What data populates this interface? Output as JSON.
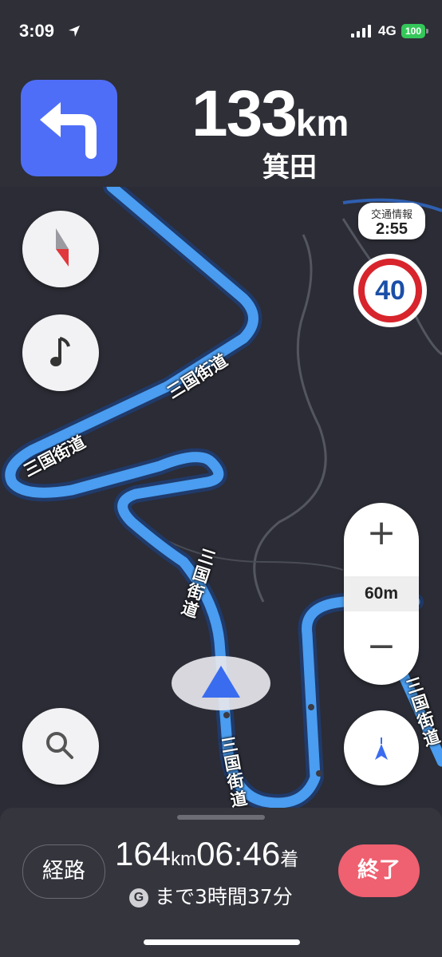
{
  "status_bar": {
    "time": "3:09",
    "network": "4G",
    "battery": "100"
  },
  "navigation": {
    "distance_value": "133",
    "distance_unit": "km",
    "destination_place": "箕田",
    "turn": "left"
  },
  "map": {
    "road_labels": [
      "三国街道",
      "三国街道",
      "三国街道",
      "三国街道",
      "三国街道"
    ],
    "traffic_info": {
      "label": "交通情報",
      "value": "2:55"
    },
    "speed_limit": "40",
    "zoom_scale": "60m",
    "zoom_in": "+",
    "zoom_out": "−"
  },
  "trip": {
    "route_button": "経路",
    "remaining_distance": "164",
    "distance_unit": "km",
    "arrival_time": "06:46",
    "arrival_suffix": "着",
    "g_icon": "G",
    "remaining_time": "まで3時間37分",
    "end_button": "終了"
  },
  "colors": {
    "accent_blue": "#4f6ef7",
    "route_blue": "#4a9df0",
    "end_red": "#ef6070",
    "battery_green": "#34c759"
  }
}
